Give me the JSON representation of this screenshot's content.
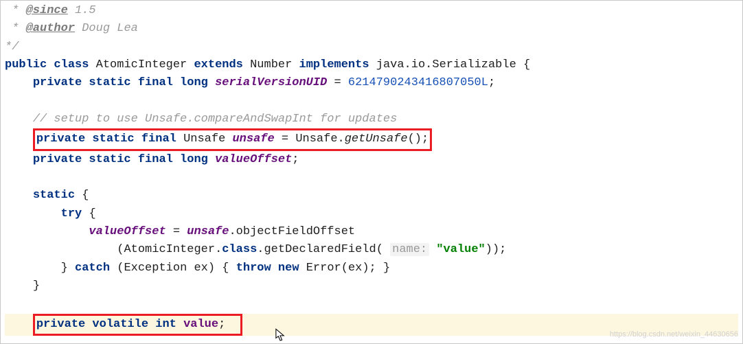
{
  "code": {
    "javadoc": {
      "since_tag": "@since",
      "since_val": "1.5",
      "author_tag": "@author",
      "author_val": "Doug Lea"
    },
    "class_decl": {
      "mod_public": "public",
      "kw_class": "class",
      "name": "AtomicInteger",
      "kw_extends": "extends",
      "super": "Number",
      "kw_implements": "implements",
      "iface": "java.io.Serializable"
    },
    "serial": {
      "mods": "private static final long",
      "name": "serialVersionUID",
      "eq": " = ",
      "value": "6214790243416807050L",
      "semi": ";"
    },
    "setup_comment": "// setup to use Unsafe.compareAndSwapInt for updates",
    "unsafe_decl": {
      "mods": "private static final",
      "type": "Unsafe",
      "name": "unsafe",
      "eq": " = ",
      "call_class": "Unsafe",
      "call_method": "getUnsafe",
      "tail": "();"
    },
    "offset_decl": {
      "mods": "private static final long",
      "name": "valueOffset",
      "semi": ";"
    },
    "static_block": {
      "kw_static": "static",
      "kw_try": "try",
      "assign_target": "valueOffset",
      "eq": " = ",
      "unsafe_ref": "unsafe",
      "method1": "objectFieldOffset",
      "cls_ref": "AtomicInteger",
      "class_kw": "class",
      "method2": "getDeclaredField",
      "hint": "name:",
      "arg": "\"value\"",
      "kw_catch": "catch",
      "exc_type": "Exception",
      "exc_var": "ex",
      "kw_throw": "throw",
      "kw_new": "new",
      "err": "Error",
      "err_arg": "(ex); }"
    },
    "value_decl": {
      "mods": "private volatile int",
      "name": "value",
      "semi": ";"
    }
  },
  "watermark": "https://blog.csdn.net/weixin_44630656"
}
